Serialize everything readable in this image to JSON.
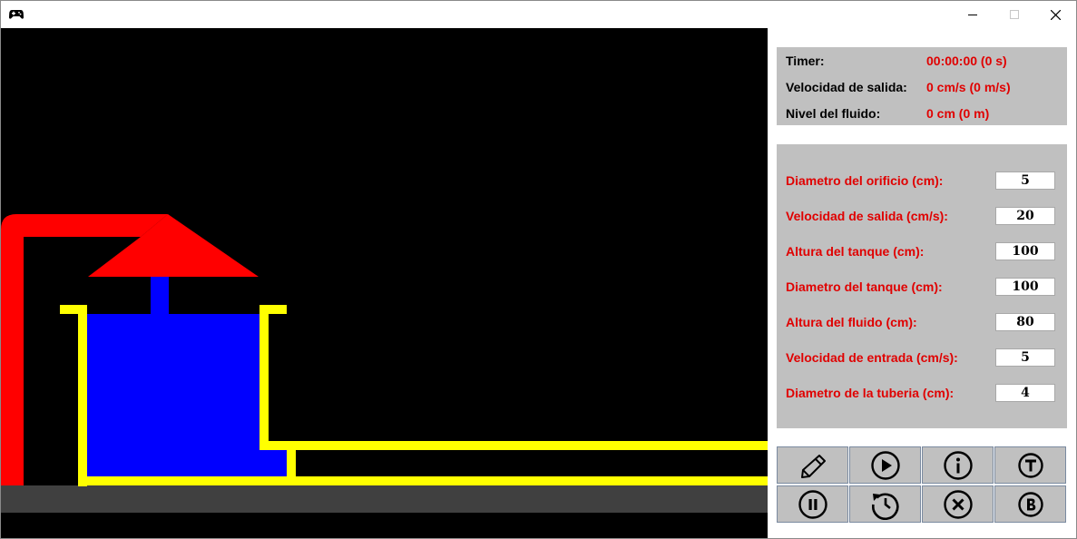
{
  "window": {
    "app_icon": "gamepad-icon",
    "controls": [
      "minimize-icon",
      "maximize-icon",
      "close-icon"
    ]
  },
  "status": {
    "timer_label": "Timer:",
    "timer_value": "00:00:00 (0 s)",
    "velocity_label": "Velocidad de salida:",
    "velocity_value": "0 cm/s (0 m/s)",
    "level_label": "Nivel del fluido:",
    "level_value": "0 cm (0 m)"
  },
  "params": [
    {
      "label": "Diametro del orificio (cm):",
      "value": "5"
    },
    {
      "label": "Velocidad de salida (cm/s):",
      "value": "20"
    },
    {
      "label": "Altura del tanque (cm):",
      "value": "100"
    },
    {
      "label": "Diametro del tanque (cm):",
      "value": "100"
    },
    {
      "label": "Altura del fluido (cm):",
      "value": "80"
    },
    {
      "label": "Velocidad de entrada (cm/s):",
      "value": "5"
    },
    {
      "label": "Diametro de la tuberia (cm):",
      "value": "4"
    }
  ],
  "toolbar": [
    "pencil-icon",
    "play-icon",
    "info-icon",
    "t-circle-icon",
    "pause-icon",
    "history-icon",
    "cancel-icon",
    "b-circle-icon"
  ],
  "colors": {
    "pipe": "#ff0000",
    "tank_wall": "#ffff00",
    "fluid": "#0000ff",
    "ground": "#404040",
    "panel_box": "#c0c0c0",
    "value_text": "#e00000"
  }
}
